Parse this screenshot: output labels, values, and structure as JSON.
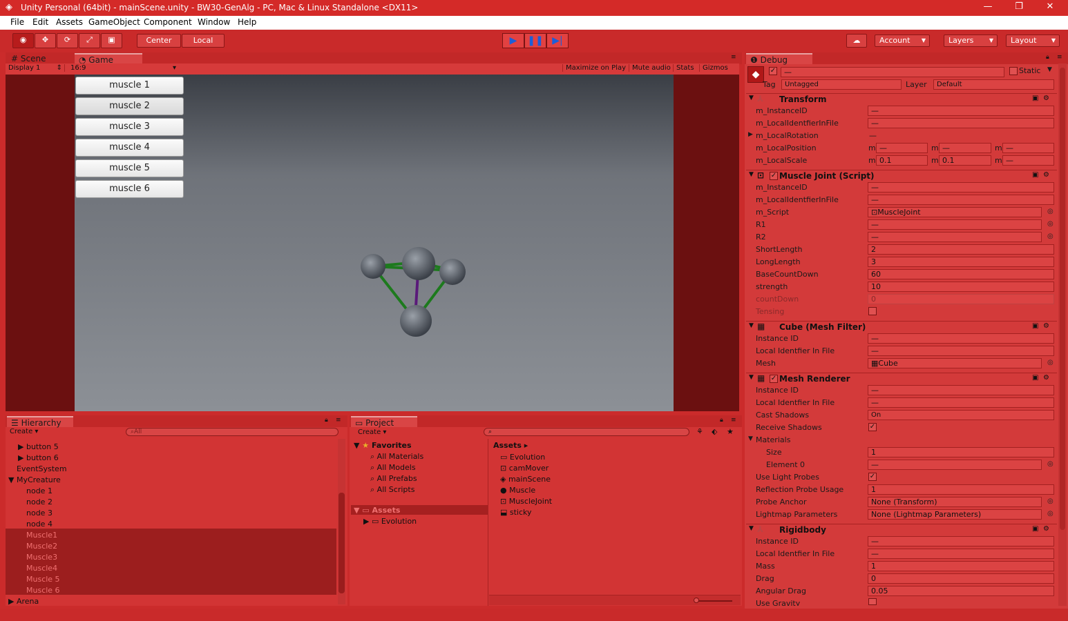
{
  "window": {
    "title": "Unity Personal (64bit) - mainScene.unity - BW30-GenAlg - PC, Mac & Linux Standalone <DX11>"
  },
  "menu": [
    "File",
    "Edit",
    "Assets",
    "GameObject",
    "Component",
    "Window",
    "Help"
  ],
  "toolbar": {
    "center_label": "Center",
    "local_label": "Local",
    "account_label": "Account",
    "layers_label": "Layers",
    "layout_label": "Layout"
  },
  "tabs": {
    "scene": "Scene",
    "game": "Game",
    "debug": "Debug",
    "hierarchy": "Hierarchy",
    "project": "Project"
  },
  "game": {
    "display": "Display 1",
    "aspect": "16:9",
    "maximize": "Maximize on Play",
    "mute": "Mute audio",
    "stats": "Stats",
    "gizmos": "Gizmos",
    "buttons": [
      "muscle 1",
      "muscle 2",
      "muscle 3",
      "muscle 4",
      "muscle 5",
      "muscle 6"
    ]
  },
  "inspector": {
    "name_value": "—",
    "static_label": "Static",
    "tag_label": "Tag",
    "tag_value": "Untagged",
    "layer_label": "Layer",
    "layer_value": "Default",
    "transform": {
      "title": "Transform",
      "rows": [
        {
          "label": "m_InstanceID",
          "value": "—"
        },
        {
          "label": "m_LocalIdentfierInFile",
          "value": "—"
        },
        {
          "label": "m_LocalRotation",
          "value": "—"
        }
      ],
      "pos_label": "m_LocalPosition",
      "pos": [
        "—",
        "—",
        "—"
      ],
      "scale_label": "m_LocalScale",
      "scale": [
        "0.1",
        "0.1",
        "—"
      ],
      "axis": "m"
    },
    "muscle": {
      "title": "Muscle Joint (Script)",
      "rows": [
        {
          "label": "m_InstanceID",
          "value": "—"
        },
        {
          "label": "m_LocalIdentfierInFile",
          "value": "—"
        },
        {
          "label": "m_Script",
          "value": "MuscleJoint"
        },
        {
          "label": "R1",
          "value": "—"
        },
        {
          "label": "R2",
          "value": "—"
        },
        {
          "label": "ShortLength",
          "value": "2"
        },
        {
          "label": "LongLength",
          "value": "3"
        },
        {
          "label": "BaseCountDown",
          "value": "60"
        },
        {
          "label": "strength",
          "value": "10"
        },
        {
          "label": "countDown",
          "value": "0"
        },
        {
          "label": "Tensing",
          "value": ""
        }
      ]
    },
    "meshfilter": {
      "title": "Cube (Mesh Filter)",
      "rows": [
        {
          "label": "Instance ID",
          "value": "—"
        },
        {
          "label": "Local Identfier In File",
          "value": "—"
        },
        {
          "label": "Mesh",
          "value": "Cube"
        }
      ]
    },
    "renderer": {
      "title": "Mesh Renderer",
      "rows": [
        {
          "label": "Instance ID",
          "value": "—"
        },
        {
          "label": "Local Identfier In File",
          "value": "—"
        },
        {
          "label": "Cast Shadows",
          "value": "On"
        },
        {
          "label": "Receive Shadows",
          "value": ""
        },
        {
          "label": "Materials",
          "value": ""
        },
        {
          "label": "Size",
          "value": "1"
        },
        {
          "label": "Element 0",
          "value": "—"
        },
        {
          "label": "Use Light Probes",
          "value": ""
        },
        {
          "label": "Reflection Probe Usage",
          "value": "1"
        },
        {
          "label": "Probe Anchor",
          "value": "None (Transform)"
        },
        {
          "label": "Lightmap Parameters",
          "value": "None (Lightmap Parameters)"
        }
      ]
    },
    "rigidbody": {
      "title": "Rigidbody",
      "rows": [
        {
          "label": "Instance ID",
          "value": "—"
        },
        {
          "label": "Local Identfier In File",
          "value": "—"
        },
        {
          "label": "Mass",
          "value": "1"
        },
        {
          "label": "Drag",
          "value": "0"
        },
        {
          "label": "Angular Drag",
          "value": "0.05"
        },
        {
          "label": "Use Gravity",
          "value": ""
        }
      ]
    }
  },
  "hierarchy": {
    "create": "Create",
    "search_placeholder": "All",
    "items": [
      "button 5",
      "button 6",
      "EventSystem",
      "MyCreature",
      "node 1",
      "node 2",
      "node 3",
      "node 4",
      "Muscle1",
      "Muscle2",
      "Muscle3",
      "Muscle4",
      "Muscle 5",
      "Muscle 6",
      "Arena"
    ]
  },
  "project": {
    "create": "Create",
    "favorites_label": "Favorites",
    "favorites": [
      "All Materials",
      "All Models",
      "All Prefabs",
      "All Scripts"
    ],
    "assets_label": "Assets",
    "tree": [
      "Evolution"
    ],
    "breadcrumb": "Assets",
    "files": [
      "Evolution",
      "camMover",
      "mainScene",
      "Muscle",
      "MuscleJoint",
      "sticky"
    ]
  }
}
